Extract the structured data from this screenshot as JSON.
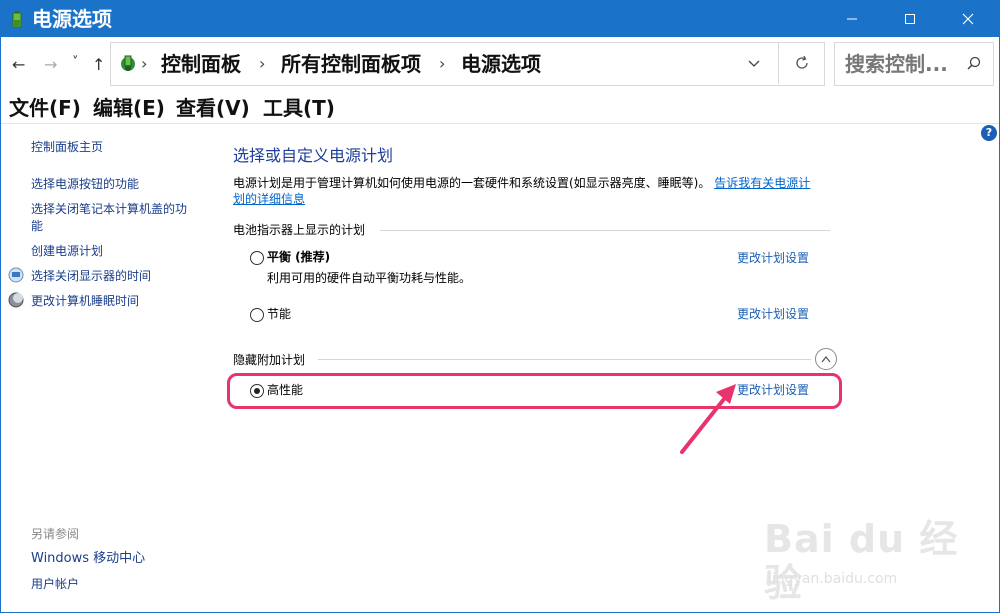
{
  "window": {
    "title": "电源选项",
    "minimize_icon": "minimize-icon",
    "maximize_icon": "maximize-icon",
    "close_icon": "close-icon"
  },
  "nav": {
    "back": "←",
    "forward": "→",
    "recent": "˅",
    "up": "↑",
    "separator": "›",
    "breadcrumbs": [
      "控制面板",
      "所有控制面板项",
      "电源选项"
    ],
    "search_placeholder": "搜索控制..."
  },
  "menu": [
    "文件(F)",
    "编辑(E)",
    "查看(V)",
    "工具(T)"
  ],
  "sidebar": {
    "home": "控制面板主页",
    "links": [
      "选择电源按钮的功能",
      "选择关闭笔记本计算机盖的功",
      "能",
      "创建电源计划",
      "选择关闭显示器的时间",
      "更改计算机睡眠时间"
    ],
    "see_also_title": "另请参阅",
    "see_also": [
      "Windows 移动中心",
      "用户帐户"
    ]
  },
  "main": {
    "heading": "选择或自定义电源计划",
    "description": "电源计划是用于管理计算机如何使用电源的一套硬件和系统设置(如显示器亮度、睡眠等)。",
    "desc_link_1": "告诉我有关电源计",
    "desc_link_2": "划的详细信息",
    "battery_group": "电池指示器上显示的计划",
    "hidden_group": "隐藏附加计划",
    "change_link": "更改计划设置",
    "plans": [
      {
        "name": "平衡 (推荐)",
        "desc": "利用可用的硬件自动平衡功耗与性能。",
        "selected": false
      },
      {
        "name": "节能",
        "desc": "",
        "selected": false
      },
      {
        "name": "高性能",
        "desc": "",
        "selected": true
      }
    ],
    "help": "?"
  },
  "annotation": {
    "color": "#e8336b"
  },
  "watermark": {
    "text": "Bai du 经验",
    "sub": "jingyan.baidu.com"
  }
}
